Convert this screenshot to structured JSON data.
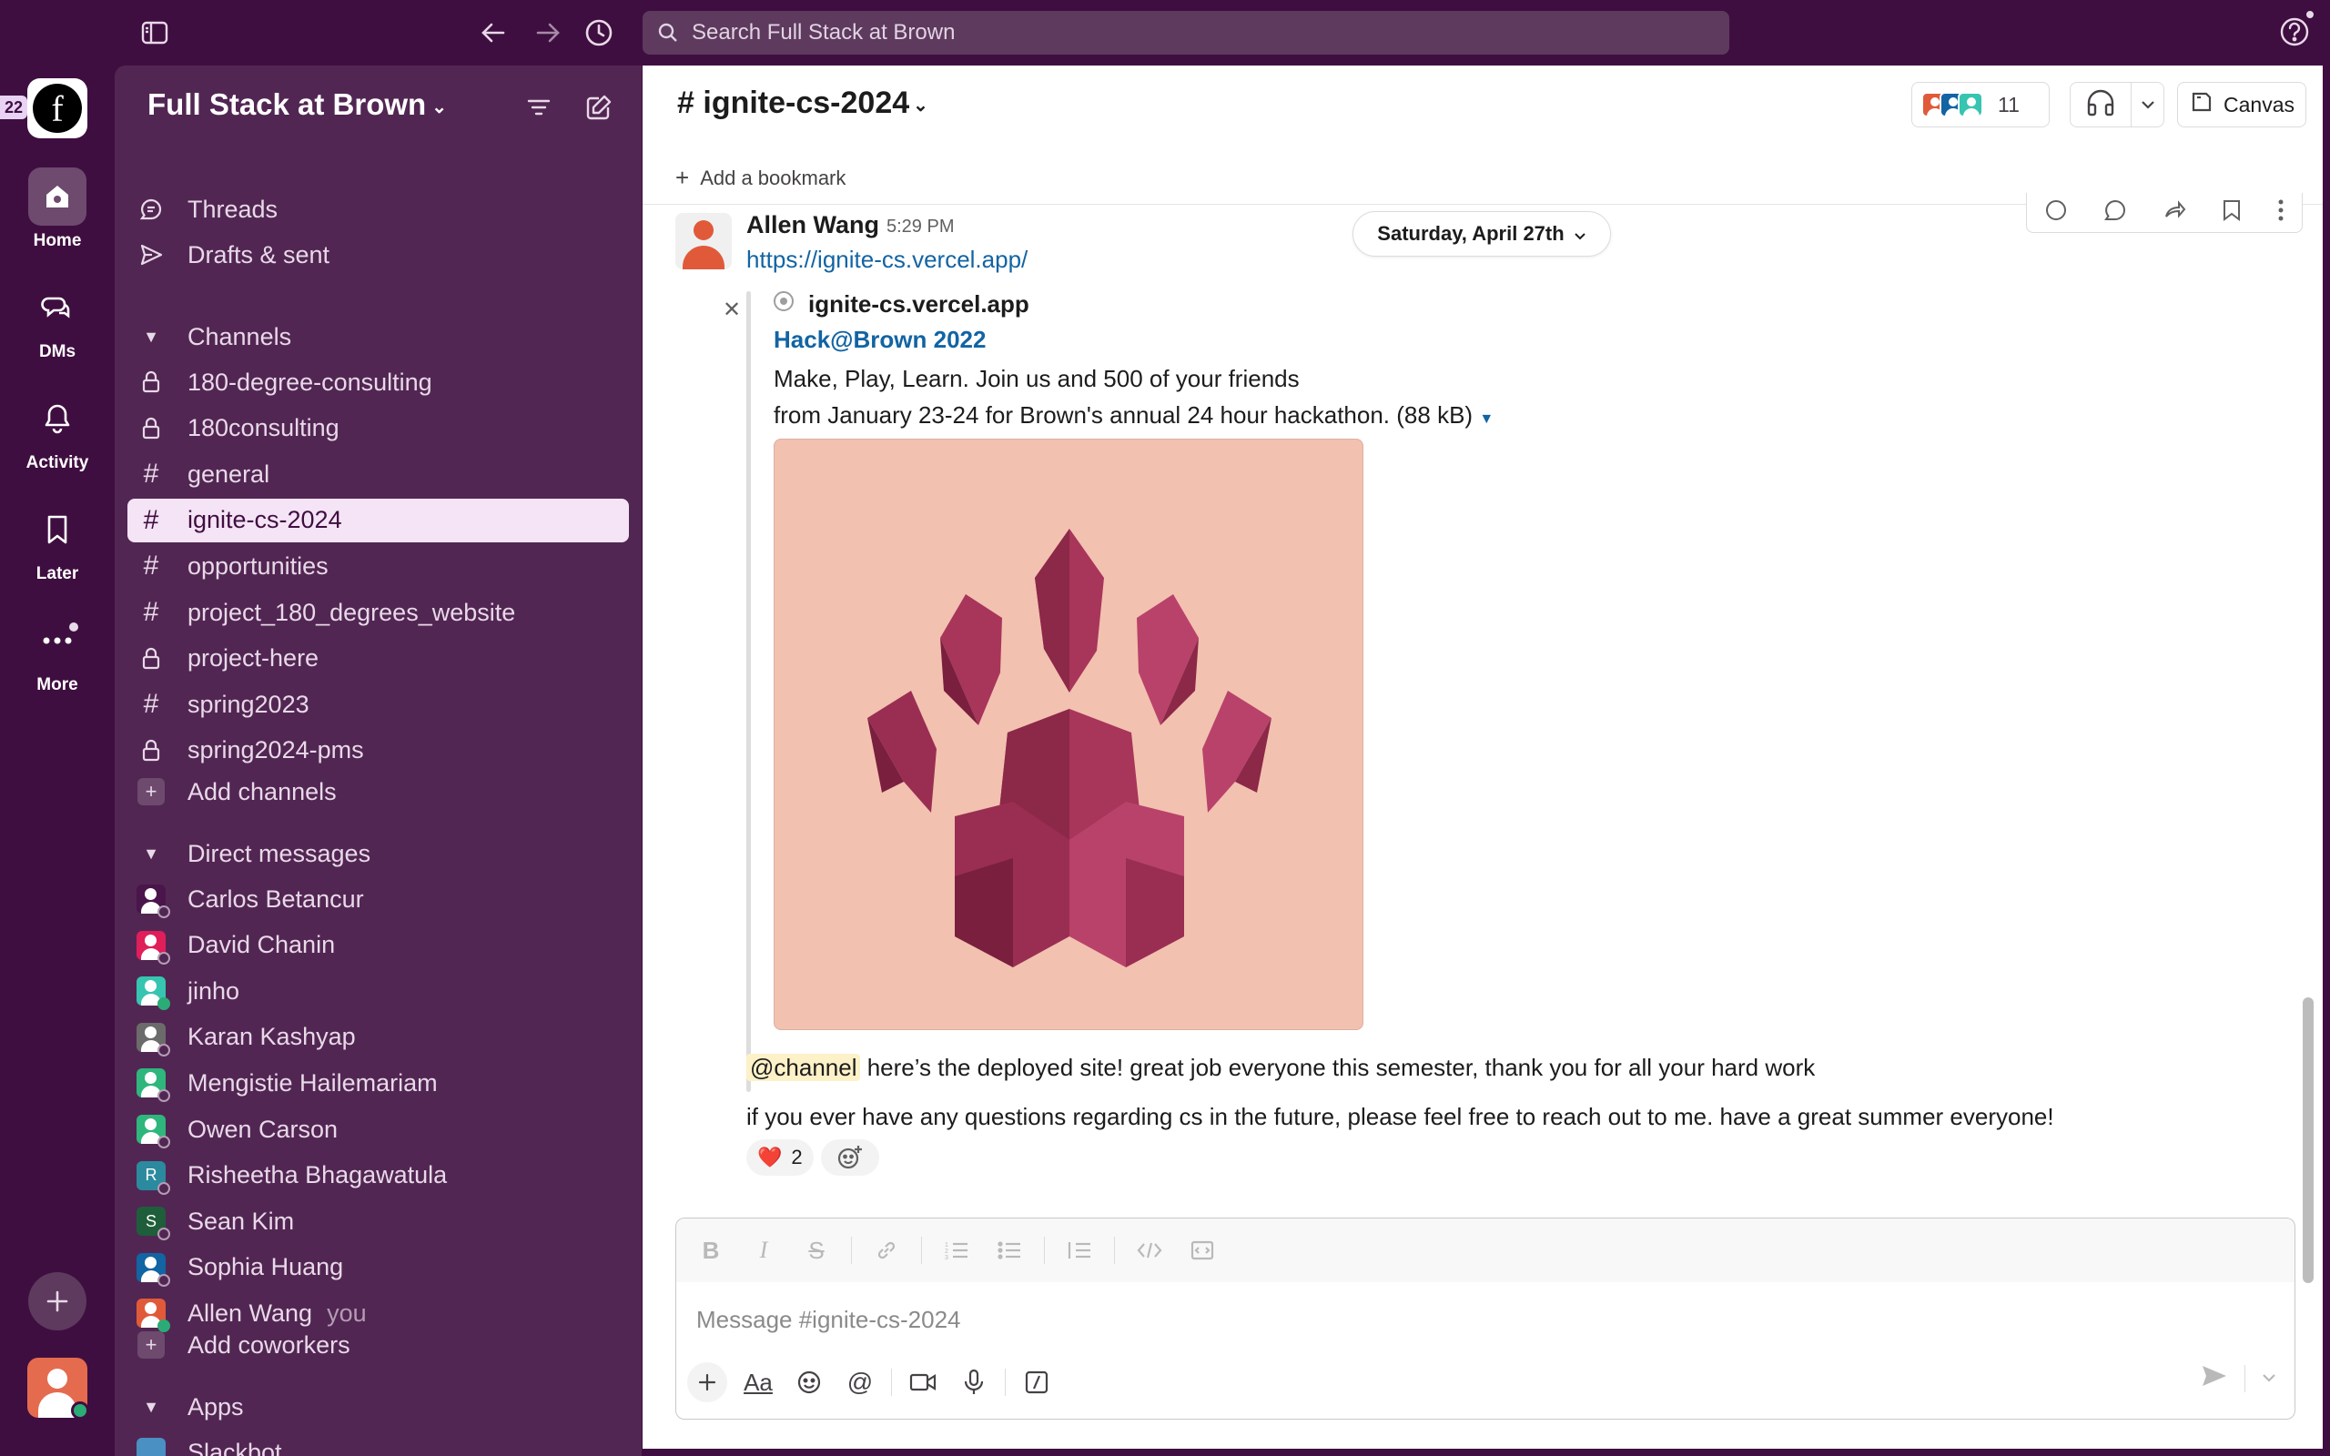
{
  "topbar": {
    "search_placeholder": "Search Full Stack at Brown"
  },
  "rail": {
    "workspace_badge": "22",
    "workspace_initial": "f",
    "items": [
      {
        "label": "Home",
        "icon": "home-icon"
      },
      {
        "label": "DMs",
        "icon": "dms-icon"
      },
      {
        "label": "Activity",
        "icon": "bell-icon"
      },
      {
        "label": "Later",
        "icon": "bookmark-icon"
      },
      {
        "label": "More",
        "icon": "more-icon"
      }
    ]
  },
  "sidebar": {
    "workspace_name": "Full Stack at Brown",
    "threads": "Threads",
    "drafts": "Drafts & sent",
    "channels_header": "Channels",
    "channels": [
      {
        "name": "180-degree-consulting",
        "private": true
      },
      {
        "name": "180consulting",
        "private": true
      },
      {
        "name": "general",
        "private": false
      },
      {
        "name": "ignite-cs-2024",
        "private": false,
        "active": true
      },
      {
        "name": "opportunities",
        "private": false
      },
      {
        "name": "project_180_degrees_website",
        "private": false
      },
      {
        "name": "project-here",
        "private": true
      },
      {
        "name": "spring2023",
        "private": false
      },
      {
        "name": "spring2024-pms",
        "private": true
      }
    ],
    "add_channels": "Add channels",
    "dm_header": "Direct messages",
    "dms": [
      {
        "name": "Carlos Betancur",
        "color": "#4a154b",
        "online": false
      },
      {
        "name": "David Chanin",
        "color": "#e01e5a",
        "online": false
      },
      {
        "name": "jinho",
        "color": "#36c5b0",
        "online": true
      },
      {
        "name": "Karan Kashyap",
        "color": "#6b6b6b",
        "online": false
      },
      {
        "name": "Mengistie Hailemariam",
        "color": "#2eb67d",
        "online": false
      },
      {
        "name": "Owen Carson",
        "color": "#2eb67d",
        "online": false
      },
      {
        "name": "Risheetha Bhagawatula",
        "color": "#2b8a9e",
        "online": false,
        "letter": "R"
      },
      {
        "name": "Sean Kim",
        "color": "#1e5e3a",
        "online": false,
        "letter": "S"
      },
      {
        "name": "Sophia Huang",
        "color": "#1264a3",
        "online": false
      },
      {
        "name": "Allen Wang",
        "color": "#e05a3a",
        "online": true,
        "you": "you"
      }
    ],
    "add_coworkers": "Add coworkers",
    "apps_header": "Apps",
    "apps": [
      "Slackbot"
    ]
  },
  "channel": {
    "name": "ignite-cs-2024",
    "member_count": "11",
    "canvas_label": "Canvas",
    "add_bookmark": "Add a bookmark"
  },
  "message": {
    "author": "Allen Wang",
    "time": "5:29 PM",
    "date_divider": "Saturday, April 27th",
    "link": "https://ignite-cs.vercel.app/",
    "unfurl": {
      "site": "ignite-cs.vercel.app",
      "title": "Hack@Brown 2022",
      "desc_line1": "Make, Play, Learn. Join us and 500 of your friends",
      "desc_line2": "from January 23-24 for Brown's annual 24 hour hackathon.",
      "size": "(88 kB)"
    },
    "mention": "@channel",
    "line1_rest": " here’s the deployed site! great job everyone this semester, thank you for all your hard work",
    "line2": "if you ever have any questions regarding cs in the future, please feel free to reach out to me. have a great summer everyone!",
    "reaction_emoji": "❤️",
    "reaction_count": "2"
  },
  "composer": {
    "placeholder": "Message #ignite-cs-2024"
  },
  "colors": {
    "aubergine": "#3f0e40",
    "sidebar": "#522653",
    "link": "#1264a3",
    "online": "#2bac76"
  }
}
